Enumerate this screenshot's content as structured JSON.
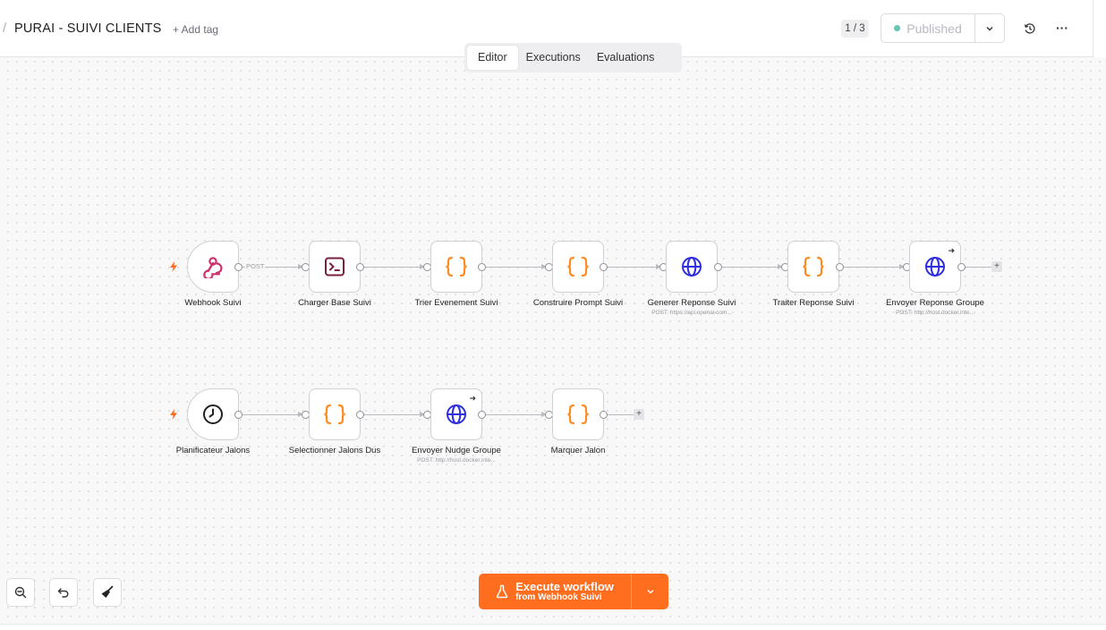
{
  "header": {
    "breadcrumb_separator": "/",
    "workflow_title": "PURAI - SUIVI CLIENTS",
    "add_tag_label": "+ Add tag",
    "version_indicator": "1 / 3",
    "publish_label": "Published",
    "more_label": "···"
  },
  "tabs": [
    {
      "label": "Editor",
      "active": true
    },
    {
      "label": "Executions",
      "active": false
    },
    {
      "label": "Evaluations",
      "active": false
    }
  ],
  "canvas": {
    "row1_nodes": [
      {
        "label": "Webhook Suivi",
        "icon": "webhook-icon",
        "subtitle": ""
      },
      {
        "label": "Charger Base Suivi",
        "icon": "terminal-icon",
        "subtitle": ""
      },
      {
        "label": "Trier Evenement Suivi",
        "icon": "code-braces-icon",
        "subtitle": ""
      },
      {
        "label": "Construire Prompt Suivi",
        "icon": "code-braces-icon",
        "subtitle": ""
      },
      {
        "label": "Generer Reponse Suivi",
        "icon": "globe-icon",
        "subtitle": "POST: https://api.openai.com..."
      },
      {
        "label": "Traiter Reponse Suivi",
        "icon": "code-braces-icon",
        "subtitle": ""
      },
      {
        "label": "Envoyer Reponse Groupe",
        "icon": "globe-icon",
        "subtitle": "POST: http://host.docker.inte..."
      }
    ],
    "row2_nodes": [
      {
        "label": "Planificateur Jalons",
        "icon": "clock-icon",
        "subtitle": ""
      },
      {
        "label": "Selectionner Jalons Dus",
        "icon": "code-braces-icon",
        "subtitle": ""
      },
      {
        "label": "Envoyer Nudge Groupe",
        "icon": "globe-icon",
        "subtitle": "POST: http://host.docker.inte..."
      },
      {
        "label": "Marquer Jalon",
        "icon": "code-braces-icon",
        "subtitle": ""
      }
    ],
    "webhook_method_label": "POST",
    "add_node_symbol": "+"
  },
  "execute": {
    "title": "Execute workflow",
    "subtitle": "from Webhook Suivi"
  },
  "colors": {
    "accent": "#ff6d1f",
    "code_icon": "#ff8a1f",
    "globe_icon": "#2e2ee0",
    "webhook_icon": "#d0316f",
    "terminal_icon": "#7a1f3d",
    "published_dot": "#63c6b6"
  }
}
